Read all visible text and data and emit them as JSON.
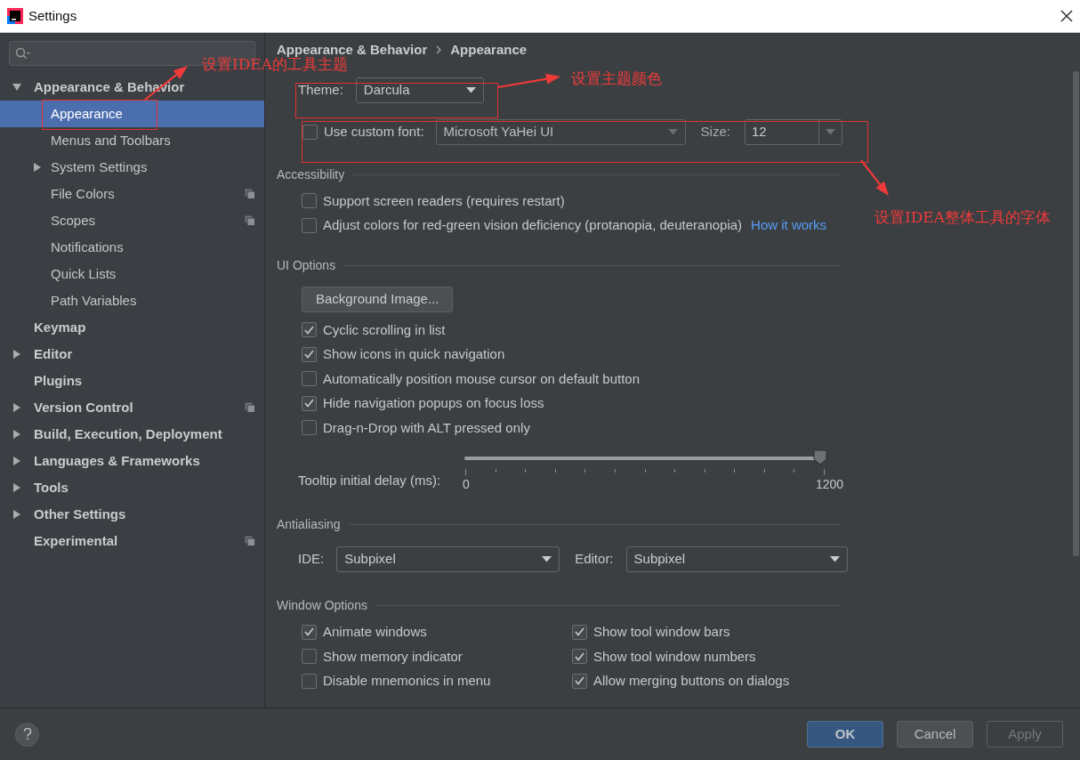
{
  "window": {
    "title": "Settings"
  },
  "sidebar": {
    "items": [
      {
        "label": "Appearance & Behavior",
        "expanded": true,
        "selected": false,
        "project_level": false,
        "children": [
          {
            "label": "Appearance",
            "selected": true,
            "project_level": false
          },
          {
            "label": "Menus and Toolbars",
            "selected": false,
            "project_level": false
          },
          {
            "label": "System Settings",
            "expanded": false,
            "selected": false,
            "project_level": false
          },
          {
            "label": "File Colors",
            "selected": false,
            "project_level": true
          },
          {
            "label": "Scopes",
            "selected": false,
            "project_level": true
          },
          {
            "label": "Notifications",
            "selected": false,
            "project_level": false
          },
          {
            "label": "Quick Lists",
            "selected": false,
            "project_level": false
          },
          {
            "label": "Path Variables",
            "selected": false,
            "project_level": false
          }
        ]
      },
      {
        "label": "Keymap",
        "selected": false,
        "project_level": false
      },
      {
        "label": "Editor",
        "expanded": false,
        "selected": false,
        "project_level": false
      },
      {
        "label": "Plugins",
        "selected": false,
        "project_level": false
      },
      {
        "label": "Version Control",
        "expanded": false,
        "selected": false,
        "project_level": true
      },
      {
        "label": "Build, Execution, Deployment",
        "expanded": false,
        "selected": false,
        "project_level": false
      },
      {
        "label": "Languages & Frameworks",
        "expanded": false,
        "selected": false,
        "project_level": false
      },
      {
        "label": "Tools",
        "expanded": false,
        "selected": false,
        "project_level": false
      },
      {
        "label": "Other Settings",
        "expanded": false,
        "selected": false,
        "project_level": false
      },
      {
        "label": "Experimental",
        "selected": false,
        "project_level": true
      }
    ]
  },
  "breadcrumb": [
    "Appearance & Behavior",
    "Appearance"
  ],
  "theme": {
    "label": "Theme:",
    "value": "Darcula"
  },
  "custom_font": {
    "checked": false,
    "label": "Use custom font:",
    "value": "Microsoft YaHei UI",
    "size_label": "Size:",
    "size": "12"
  },
  "accessibility": {
    "title": "Accessibility",
    "options": [
      {
        "label": "Support screen readers (requires restart)",
        "checked": false
      },
      {
        "label": "Adjust colors for red-green vision deficiency (protanopia, deuteranopia)",
        "checked": false,
        "link": "How it works"
      }
    ]
  },
  "ui_options": {
    "title": "UI Options",
    "button": "Background Image...",
    "options": [
      {
        "label": "Cyclic scrolling in list",
        "checked": true
      },
      {
        "label": "Show icons in quick navigation",
        "checked": true
      },
      {
        "label": "Automatically position mouse cursor on default button",
        "checked": false
      },
      {
        "label": "Hide navigation popups on focus loss",
        "checked": true
      },
      {
        "label": "Drag-n-Drop with ALT pressed only",
        "checked": false
      }
    ],
    "slider": {
      "label": "Tooltip initial delay (ms):",
      "level": 1,
      "min_label": "0",
      "max_label": "1200"
    }
  },
  "antialiasing": {
    "title": "Antialiasing",
    "ide_label": "IDE:",
    "ide_value": "Subpixel",
    "editor_label": "Editor:",
    "editor_value": "Subpixel"
  },
  "window_options": {
    "title": "Window Options",
    "columns": [
      [
        {
          "label": "Animate windows",
          "checked": true
        },
        {
          "label": "Show memory indicator",
          "checked": false
        },
        {
          "label": "Disable mnemonics in menu",
          "checked": false
        }
      ],
      [
        {
          "label": "Show tool window bars",
          "checked": true
        },
        {
          "label": "Show tool window numbers",
          "checked": true
        },
        {
          "label": "Allow merging buttons on dialogs",
          "checked": true
        }
      ]
    ]
  },
  "buttons": [
    {
      "label": "OK",
      "kind": "default",
      "disabled": false
    },
    {
      "label": "Cancel",
      "kind": "normal",
      "disabled": false
    },
    {
      "label": "Apply",
      "kind": "normal",
      "disabled": true
    }
  ],
  "annotations": [
    {
      "text": "设置IDEA的工具主题"
    },
    {
      "text": "设置主题颜色"
    },
    {
      "text": "设置IDEA整体工具的字体"
    }
  ]
}
